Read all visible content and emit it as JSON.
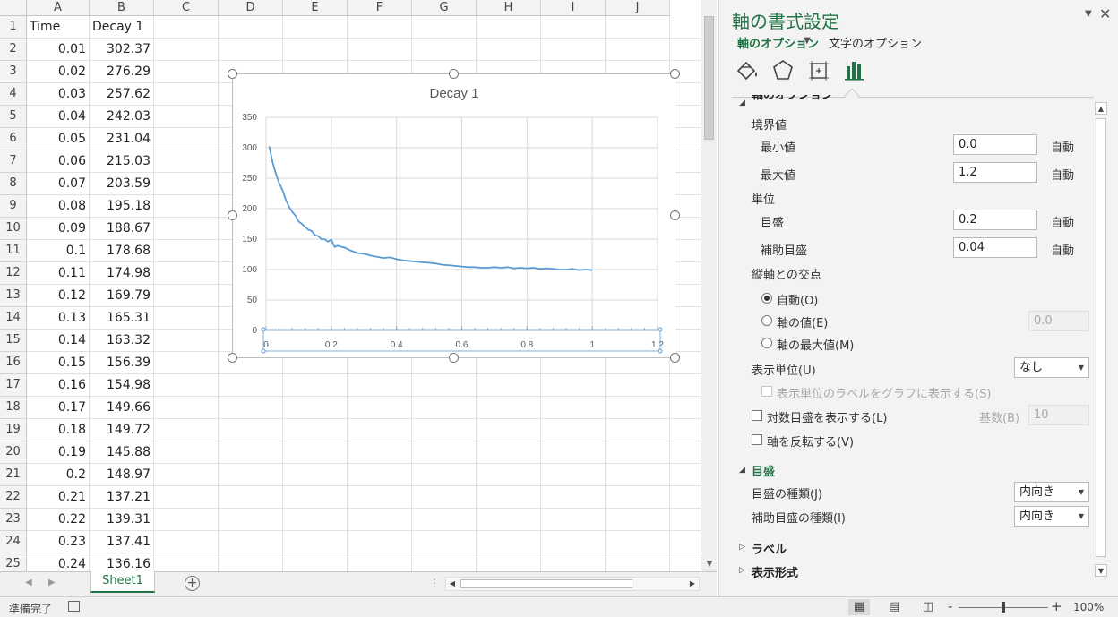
{
  "sheet": {
    "columns": [
      "A",
      "B",
      "C",
      "D",
      "E",
      "F",
      "G",
      "H",
      "I",
      "J"
    ],
    "rows": [
      {
        "n": "1",
        "a": "Time",
        "b": "Decay 1"
      },
      {
        "n": "2",
        "a": "0.01",
        "b": "302.37"
      },
      {
        "n": "3",
        "a": "0.02",
        "b": "276.29"
      },
      {
        "n": "4",
        "a": "0.03",
        "b": "257.62"
      },
      {
        "n": "5",
        "a": "0.04",
        "b": "242.03"
      },
      {
        "n": "6",
        "a": "0.05",
        "b": "231.04"
      },
      {
        "n": "7",
        "a": "0.06",
        "b": "215.03"
      },
      {
        "n": "8",
        "a": "0.07",
        "b": "203.59"
      },
      {
        "n": "9",
        "a": "0.08",
        "b": "195.18"
      },
      {
        "n": "10",
        "a": "0.09",
        "b": "188.67"
      },
      {
        "n": "11",
        "a": "0.1",
        "b": "178.68"
      },
      {
        "n": "12",
        "a": "0.11",
        "b": "174.98"
      },
      {
        "n": "13",
        "a": "0.12",
        "b": "169.79"
      },
      {
        "n": "14",
        "a": "0.13",
        "b": "165.31"
      },
      {
        "n": "15",
        "a": "0.14",
        "b": "163.32"
      },
      {
        "n": "16",
        "a": "0.15",
        "b": "156.39"
      },
      {
        "n": "17",
        "a": "0.16",
        "b": "154.98"
      },
      {
        "n": "18",
        "a": "0.17",
        "b": "149.66"
      },
      {
        "n": "19",
        "a": "0.18",
        "b": "149.72"
      },
      {
        "n": "20",
        "a": "0.19",
        "b": "145.88"
      },
      {
        "n": "21",
        "a": "0.2",
        "b": "148.97"
      },
      {
        "n": "22",
        "a": "0.21",
        "b": "137.21"
      },
      {
        "n": "23",
        "a": "0.22",
        "b": "139.31"
      },
      {
        "n": "24",
        "a": "0.23",
        "b": "137.41"
      },
      {
        "n": "25",
        "a": "0.24",
        "b": "136.16"
      }
    ],
    "tab_name": "Sheet1",
    "add_sheet_symbol": "+"
  },
  "chart_data": {
    "type": "scatter",
    "title": "Decay 1",
    "xlim": [
      0,
      1.2
    ],
    "ylim": [
      0,
      350
    ],
    "x_ticks": [
      "0",
      "0.2",
      "0.4",
      "0.6",
      "0.8",
      "1",
      "1.2"
    ],
    "y_ticks": [
      "0",
      "50",
      "100",
      "150",
      "200",
      "250",
      "300",
      "350"
    ],
    "grid": true,
    "line_color": "#5b9bd5",
    "series": [
      {
        "x": [
          0.01,
          0.02,
          0.03,
          0.04,
          0.05,
          0.06,
          0.07,
          0.08,
          0.09,
          0.1,
          0.11,
          0.12,
          0.13,
          0.14,
          0.15,
          0.16,
          0.17,
          0.18,
          0.19,
          0.2,
          0.21,
          0.22,
          0.23,
          0.24,
          0.26,
          0.28,
          0.3,
          0.32,
          0.34,
          0.36,
          0.38,
          0.4,
          0.42,
          0.44,
          0.46,
          0.48,
          0.5,
          0.52,
          0.54,
          0.56,
          0.58,
          0.6,
          0.62,
          0.64,
          0.66,
          0.68,
          0.7,
          0.72,
          0.74,
          0.76,
          0.78,
          0.8,
          0.82,
          0.84,
          0.86,
          0.88,
          0.9,
          0.92,
          0.94,
          0.96,
          0.98,
          1.0
        ],
        "y": [
          302.37,
          276.29,
          257.62,
          242.03,
          231.04,
          215.03,
          203.59,
          195.18,
          188.67,
          178.68,
          174.98,
          169.79,
          165.31,
          163.32,
          156.39,
          154.98,
          149.66,
          149.72,
          145.88,
          148.97,
          137.21,
          139.31,
          137.41,
          136.16,
          131,
          127,
          126,
          123,
          121,
          119,
          120,
          117,
          115,
          114,
          113,
          112,
          111,
          110,
          108,
          107,
          106,
          105,
          104,
          104,
          103,
          103,
          104,
          103,
          104,
          102,
          103,
          102,
          103,
          101,
          102,
          101,
          100,
          100,
          101,
          99,
          100,
          99
        ]
      }
    ]
  },
  "pane": {
    "title": "軸の書式設定",
    "tab_axis_options": "軸のオプション",
    "tab_text_options": "文字のオプション",
    "dropdown_symbol": "▼",
    "close_symbol": "✕",
    "section_axis_options": "軸のオプション",
    "bounds_label": "境界値",
    "min_label": "最小値",
    "min_value": "0.0",
    "max_label": "最大値",
    "max_value": "1.2",
    "units_label": "単位",
    "major_label": "目盛",
    "major_value": "0.2",
    "minor_label": "補助目盛",
    "minor_value": "0.04",
    "auto_label": "自動",
    "crosses_label": "縦軸との交点",
    "radio_auto": "自動(O)",
    "radio_axis_value": "軸の値(E)",
    "axis_value": "0.0",
    "radio_max": "軸の最大値(M)",
    "display_units_label": "表示単位(U)",
    "display_units_value": "なし",
    "show_units_label": "表示単位のラベルをグラフに表示する(S)",
    "log_scale_label": "対数目盛を表示する(L)",
    "base_label": "基数(B)",
    "base_value": "10",
    "reverse_label": "軸を反転する(V)",
    "section_ticks": "目盛",
    "major_tick_type_label": "目盛の種類(J)",
    "major_tick_type_value": "内向き",
    "minor_tick_type_label": "補助目盛の種類(I)",
    "minor_tick_type_value": "内向き",
    "section_labels": "ラベル",
    "section_number": "表示形式"
  },
  "status": {
    "ready": "準備完了",
    "zoom": "100%",
    "zoom_minus": "-",
    "zoom_plus": "+"
  },
  "colors": {
    "accent": "#217346",
    "series": "#5b9bd5"
  }
}
